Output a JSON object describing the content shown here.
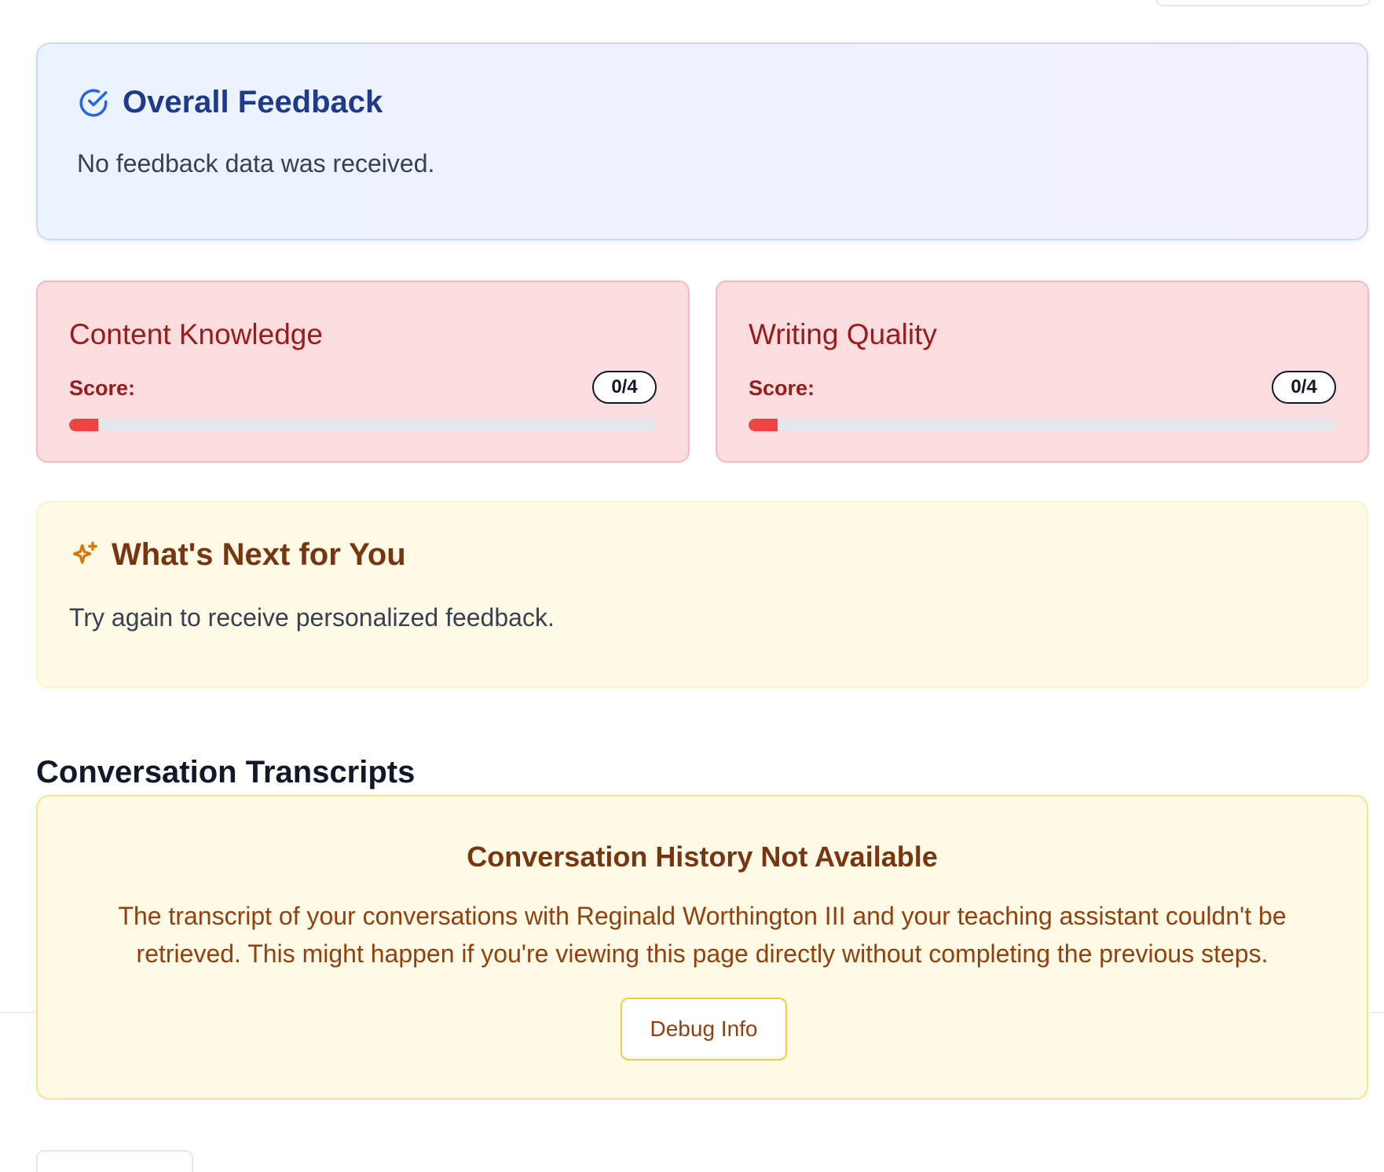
{
  "overall": {
    "title": "Overall Feedback",
    "icon": "check-circle-icon",
    "message": "No feedback data was received.",
    "accent": "#1e3a8a"
  },
  "scores": [
    {
      "title": "Content Knowledge",
      "label": "Score:",
      "value": "0/4",
      "progress_fraction": 0.05
    },
    {
      "title": "Writing Quality",
      "label": "Score:",
      "value": "0/4",
      "progress_fraction": 0.05
    }
  ],
  "next": {
    "title": "What's Next for You",
    "icon": "sparkles-icon",
    "message": "Try again to receive personalized feedback.",
    "accent": "#78350f"
  },
  "transcripts": {
    "heading": "Conversation Transcripts",
    "card_title": "Conversation History Not Available",
    "card_message": "The transcript of your conversations with Reginald Worthington III and your teaching assistant couldn't be retrieved. This might happen if you're viewing this page directly without completing the previous steps.",
    "debug_button": "Debug Info"
  },
  "colors": {
    "danger": "#ef4444",
    "score_card_bg": "#fbdde0",
    "warning_bg": "#fefae6"
  }
}
